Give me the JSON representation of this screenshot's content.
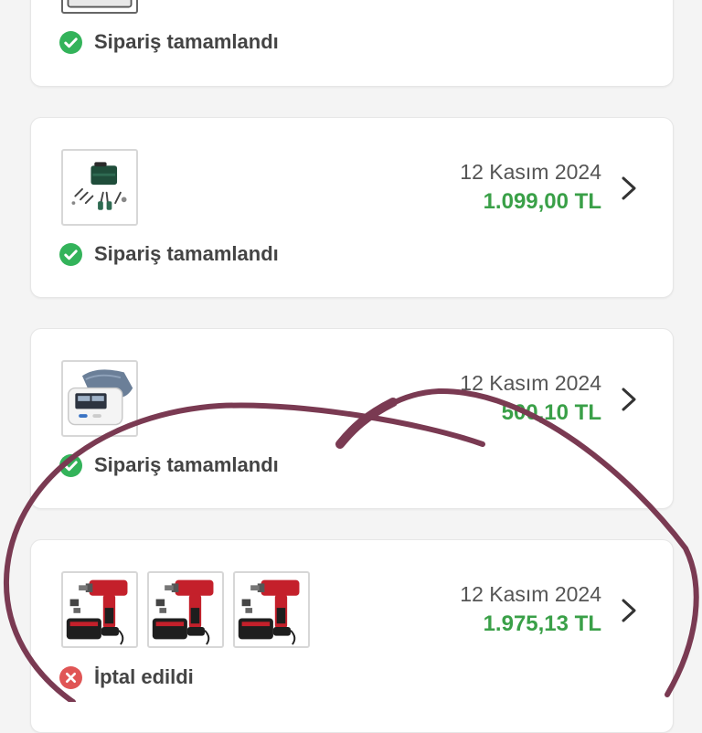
{
  "colors": {
    "background": "#f4f4f4",
    "card": "#ffffff",
    "price": "#3aa048",
    "success": "#33b35a",
    "cancelled": "#e05555",
    "annotation": "#7a3a52"
  },
  "orders": [
    {
      "date": "",
      "price": "",
      "status": "Sipariş tamamlandı",
      "status_type": "completed",
      "status_icon": "check-circle-icon",
      "thumbnails": [
        "tablet-product-image"
      ]
    },
    {
      "date": "12 Kasım 2024",
      "price": "1.099,00 TL",
      "status": "Sipariş tamamlandı",
      "status_type": "completed",
      "status_icon": "check-circle-icon",
      "thumbnails": [
        "tool-kit-image"
      ]
    },
    {
      "date": "12 Kasım 2024",
      "price": "500,10 TL",
      "status": "Sipariş tamamlandı",
      "status_type": "completed",
      "status_icon": "check-circle-icon",
      "thumbnails": [
        "blood-pressure-monitor-image"
      ]
    },
    {
      "date": "12 Kasım 2024",
      "price": "1.975,13 TL",
      "status": "İptal edildi",
      "status_type": "cancelled",
      "status_icon": "cancel-circle-icon",
      "thumbnails": [
        "impact-drill-image",
        "impact-drill-image",
        "impact-drill-image"
      ]
    }
  ],
  "chevron_icon": "chevron-right-icon"
}
